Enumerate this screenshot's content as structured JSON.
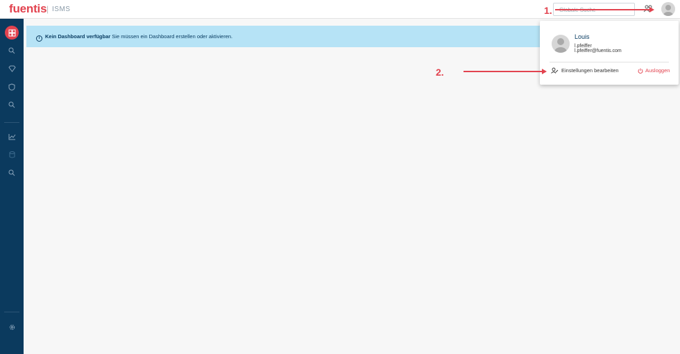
{
  "app": {
    "brand": "fuentis",
    "separator": "|",
    "product": "ISMS"
  },
  "header": {
    "search_placeholder": "Globale Suche"
  },
  "banner": {
    "title": "Kein Dashboard verfügbar",
    "message": " Sie müssen ein Dashboard erstellen oder aktivieren."
  },
  "user_menu": {
    "name": "Louis",
    "username": "l.pfeiffer",
    "email": "l.pfeiffer@fuentis.com",
    "settings_label": "Einstellungen bearbeiten",
    "logout_label": "Ausloggen"
  },
  "annotations": {
    "step1": "1.",
    "step2": "2."
  },
  "colors": {
    "brand": "#e2434f",
    "sidebar": "#0b3a5e",
    "banner": "#b6e3f6"
  }
}
